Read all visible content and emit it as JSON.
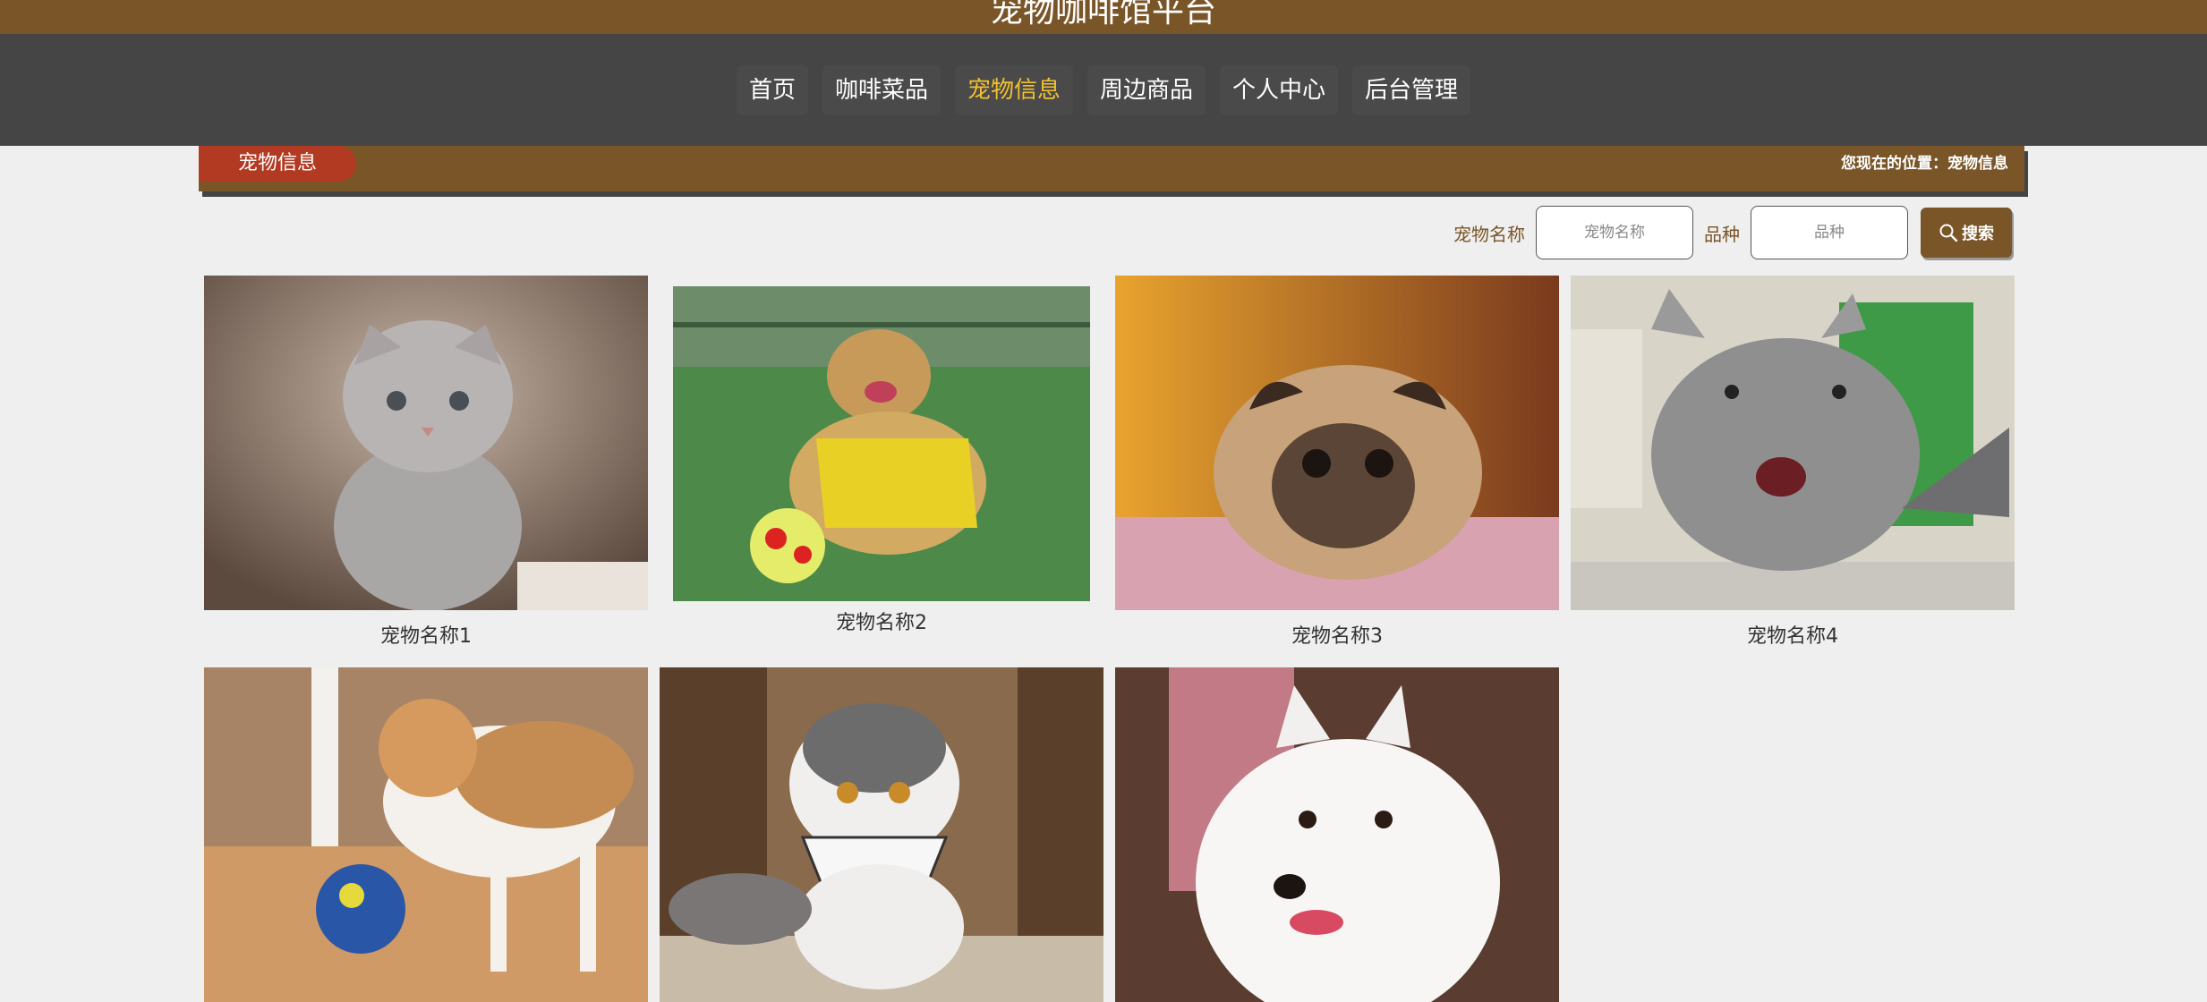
{
  "header": {
    "title": "宠物咖啡馆平台"
  },
  "nav": {
    "items": [
      {
        "label": "首页"
      },
      {
        "label": "咖啡菜品"
      },
      {
        "label": "宠物信息"
      },
      {
        "label": "周边商品"
      },
      {
        "label": "个人中心"
      },
      {
        "label": "后台管理"
      }
    ],
    "active_color": "#f2c030"
  },
  "breadcrumb": {
    "section": "宠物信息",
    "location": "您现在的位置：宠物信息"
  },
  "search": {
    "name_label": "宠物名称",
    "name_placeholder": "宠物名称",
    "breed_label": "品种",
    "breed_placeholder": "品种",
    "button_label": "搜索"
  },
  "pets": [
    {
      "name": "宠物名称1",
      "image": "grey-kitten-photo"
    },
    {
      "name": "宠物名称2",
      "image": "golden-retriever-photo"
    },
    {
      "name": "宠物名称3",
      "image": "pug-photo"
    },
    {
      "name": "宠物名称4",
      "image": "chinchilla-photo"
    },
    {
      "name": "",
      "image": "dog-with-ball-photo"
    },
    {
      "name": "",
      "image": "white-cat-bandana-photo"
    },
    {
      "name": "",
      "image": "samoyed-photo"
    }
  ],
  "colors": {
    "brand_brown": "#7a5528",
    "nav_gray": "#454545",
    "tab_red": "#b23a22"
  }
}
